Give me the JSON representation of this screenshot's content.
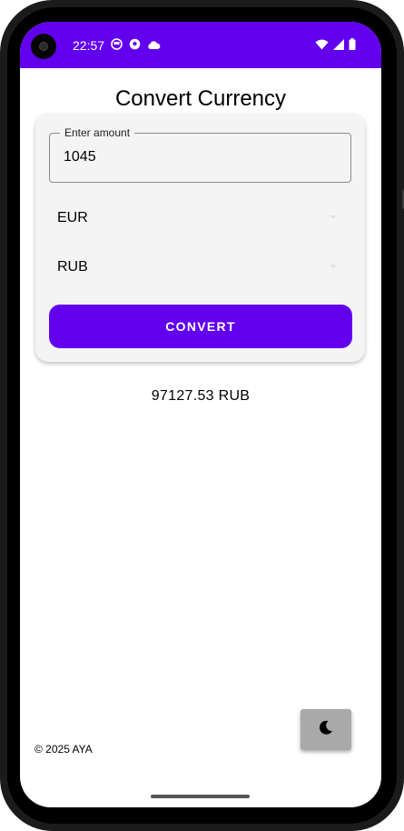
{
  "status_bar": {
    "time": "22:57",
    "icons_left": [
      "notification-app-icon",
      "soccer-ball-icon",
      "cloud-icon"
    ],
    "icons_right": [
      "wifi-icon",
      "signal-icon",
      "battery-icon"
    ],
    "color": "#6200ee"
  },
  "page": {
    "title": "Convert Currency"
  },
  "form": {
    "amount_label": "Enter amount",
    "amount_value": "1045",
    "from_currency": "EUR",
    "to_currency": "RUB",
    "convert_label": "CONVERT"
  },
  "result": {
    "text": "97127.53 RUB"
  },
  "footer": {
    "text": "© 2025 AYA"
  },
  "theme_toggle": {
    "icon": "moon-icon"
  },
  "colors": {
    "accent": "#6200ee",
    "card_bg": "#f4f4f4",
    "toggle_bg": "#a9a9a9"
  }
}
